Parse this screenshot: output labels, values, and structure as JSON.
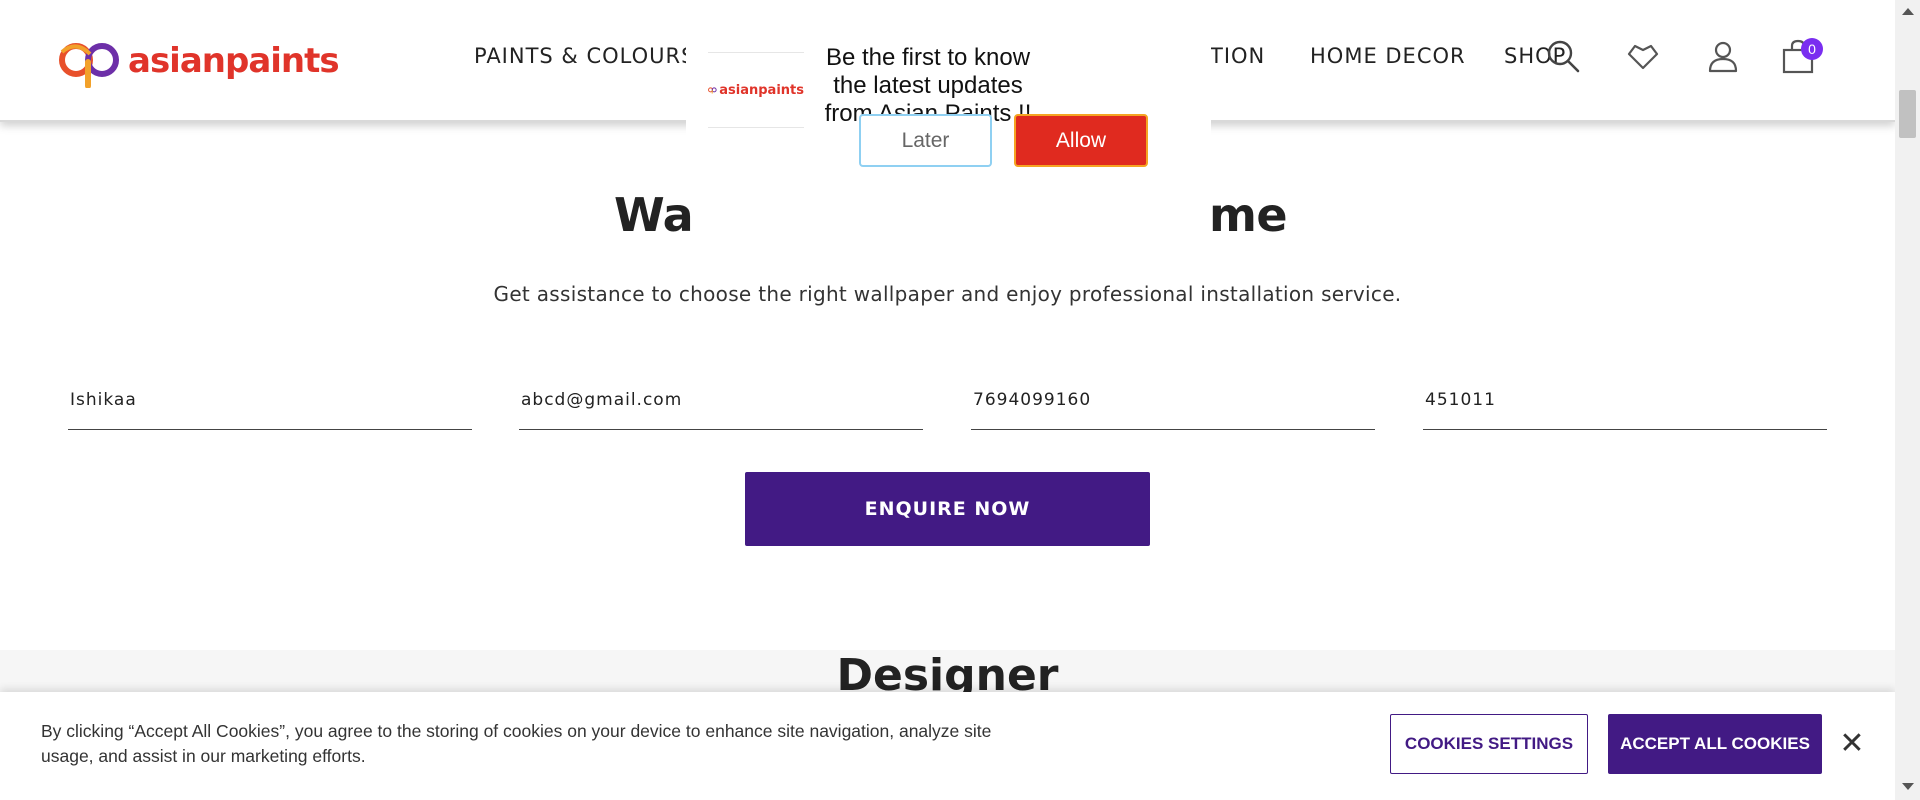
{
  "header": {
    "logo_text": "asianpaints",
    "nav": [
      "PAINTS & COLOURS",
      "TION",
      "HOME DECOR",
      "SHOP"
    ],
    "cart_count": "0",
    "icons": [
      "search-icon",
      "wishlist-heart-icon",
      "user-account-icon",
      "shopping-bag-icon"
    ]
  },
  "push_prompt": {
    "logo_text": "asianpaints",
    "message": "Be the first to know the latest updates from Asian Paints !!",
    "later_label": "Later",
    "allow_label": "Allow"
  },
  "main": {
    "headline_left": "Wa",
    "headline_right": "me",
    "subtitle": "Get assistance to choose the right wallpaper and enjoy professional installation service.",
    "fields": {
      "name": "Ishikaa",
      "email": "abcd@gmail.com",
      "phone": "7694099160",
      "pincode": "451011"
    },
    "enquire_label": "ENQUIRE NOW",
    "next_section_title": "Designer"
  },
  "cookie_banner": {
    "text": "By clicking “Accept All Cookies”, you agree to the storing of cookies on your device to enhance site navigation, analyze site usage, and assist in our marketing efforts.",
    "settings_label": "COOKIES SETTINGS",
    "accept_label": "ACCEPT ALL COOKIES",
    "close_symbol": "✕"
  },
  "colors": {
    "brand_purple": "#421a84",
    "brand_red": "#e0342a",
    "allow_red": "#e02a1f",
    "badge_purple": "#7a2ef0"
  }
}
